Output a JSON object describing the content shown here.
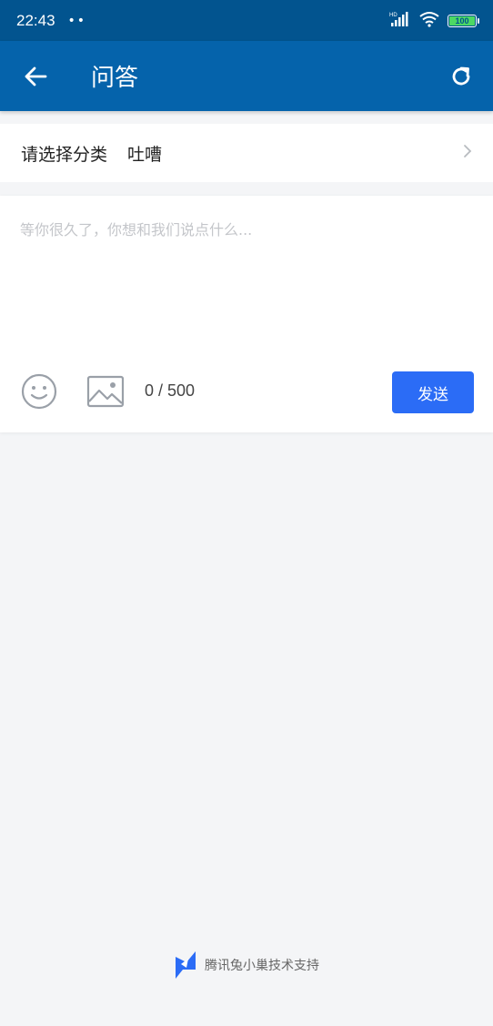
{
  "status_bar": {
    "time": "22:43",
    "dots": "••",
    "network": "HD",
    "battery": "100"
  },
  "app_bar": {
    "title": "问答"
  },
  "category": {
    "label": "请选择分类",
    "value": "吐嘈"
  },
  "compose": {
    "placeholder": "等你很久了，你想和我们说点什么...",
    "char_count": "0 / 500",
    "send_label": "发送"
  },
  "footer": {
    "text": "腾讯兔小巢技术支持"
  },
  "colors": {
    "status_bar": "#02548f",
    "app_bar": "#0563ab",
    "send_button": "#2b6cf6",
    "background": "#f4f5f7"
  }
}
